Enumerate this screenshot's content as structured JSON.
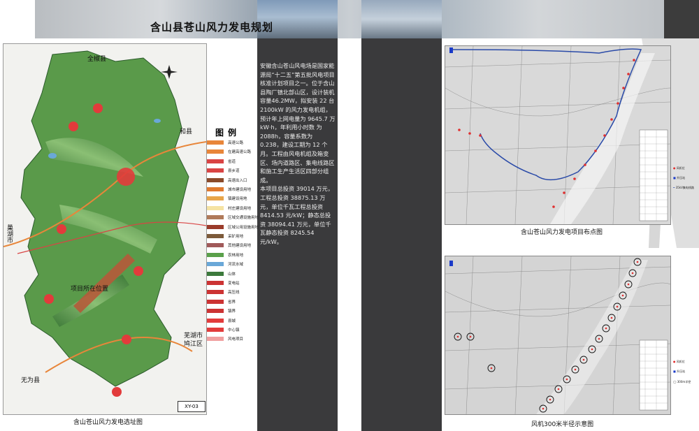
{
  "header": {
    "title": "含山县苍山风力发电规划"
  },
  "description": [
    "安徽含山苍山风电场是国家能源局“十二五”第五批风电项目核准计划项目之一。位于含山县陶厂镇北部山区，设计装机容量46.2MW，拟安装 22 台 2100kW 的风力发电机组，预计年上网电量为 9645.7 万 kW·h，年利用小时数 为 2088h，容量系数为 0.238，建设工期为 12 个月。工程由风电机组及箱变区、场内道路区、集电线路区和施工生产生活区四部分组成。",
    "本项目总投资 39014 万元，工程总投资 38875.13 万元，单位千瓦工程总投资 8414.53 元/kW；静态总投资 38094.41 万元，单位千瓦静态投资 8245.54 元/kW。"
  ],
  "left_map": {
    "caption": "含山苍山风力发电选址图",
    "project_label": "项目所在位置",
    "tag": "XY-03",
    "place_labels": {
      "north": "全椒县",
      "east": "和县",
      "west": "巢湖市",
      "southeast_1": "芜湖市",
      "southeast_2": "鸠江区",
      "southwest": "无为县"
    },
    "legend_title": "图例",
    "legend": [
      {
        "label": "高速公路",
        "color": "#e8863a"
      },
      {
        "label": "在建高速公路",
        "color": "#e8863a"
      },
      {
        "label": "省道",
        "color": "#d94444"
      },
      {
        "label": "县乡道",
        "color": "#d94444"
      },
      {
        "label": "高速出入口",
        "color": "#8a4a2a"
      },
      {
        "label": "城市建设用地",
        "color": "#e07a2e"
      },
      {
        "label": "镇建设用地",
        "color": "#e8a54a"
      },
      {
        "label": "村庄建设用地",
        "color": "#f5e3a3"
      },
      {
        "label": "区域交通设施用地",
        "color": "#b07a5a"
      },
      {
        "label": "区域公用设施用地",
        "color": "#9a3b2a"
      },
      {
        "label": "采矿用地",
        "color": "#7c5a3a"
      },
      {
        "label": "其他建设用地",
        "color": "#a05a5a"
      },
      {
        "label": "农林用地",
        "color": "#5aa04a"
      },
      {
        "label": "河流水域",
        "color": "#6aa8d8"
      },
      {
        "label": "山体",
        "color": "#3c7a3c"
      },
      {
        "label": "变电站",
        "color": "#cc3333"
      },
      {
        "label": "高压线",
        "color": "#cc3333"
      },
      {
        "label": "省界",
        "color": "#cc3333"
      },
      {
        "label": "镇界",
        "color": "#cc3333"
      },
      {
        "label": "县城",
        "color": "#e23b3b"
      },
      {
        "label": "中心镇",
        "color": "#e23b3b"
      },
      {
        "label": "风电项目",
        "color": "#f0a0a0"
      }
    ]
  },
  "right_top": {
    "caption": "含山苍山风力发电项目布点图",
    "legend": [
      "风机位",
      "升压站",
      "35kV集电线路"
    ]
  },
  "right_bottom": {
    "caption": "风机300米半径示意图",
    "legend": [
      "风机位",
      "升压站",
      "300m半径"
    ]
  },
  "colors": {
    "map_green": "#5a9a4a",
    "dark_panel": "#3a3a3c",
    "route_blue": "#2a4aa8",
    "turbine_red": "#e03030"
  }
}
